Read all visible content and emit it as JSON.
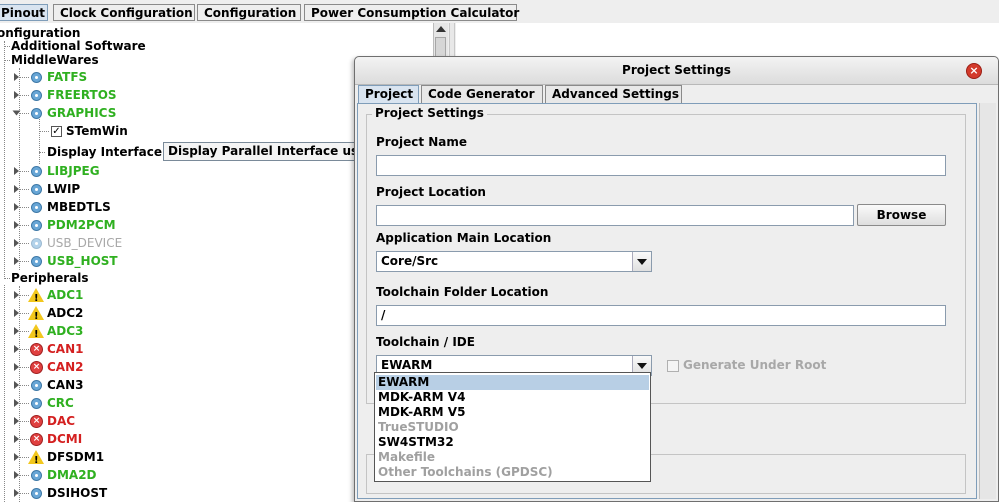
{
  "top_tabs": [
    "Pinout",
    "Clock Configuration",
    "Configuration",
    "Power Consumption Calculator"
  ],
  "tree": {
    "root": "onfiguration",
    "additional": "Additional Software",
    "middlewares": "MiddleWares",
    "mw_items": [
      "FATFS",
      "FREERTOS",
      "GRAPHICS",
      "LIBJPEG",
      "LWIP",
      "MBEDTLS",
      "PDM2PCM",
      "USB_DEVICE",
      "USB_HOST"
    ],
    "stemwin": "STemWin",
    "display_interface_label": "Display Interface",
    "display_interface_value": "Display Parallel Interface using",
    "peripherals": "Peripherals",
    "periph_items": [
      "ADC1",
      "ADC2",
      "ADC3",
      "CAN1",
      "CAN2",
      "CAN3",
      "CRC",
      "DAC",
      "DCMI",
      "DFSDM1",
      "DMA2D",
      "DSIHOST"
    ]
  },
  "dialog": {
    "title": "Project Settings",
    "close": "×",
    "tabs": [
      "Project",
      "Code Generator",
      "Advanced Settings"
    ],
    "group_title": "Project Settings",
    "project_name_label": "Project Name",
    "project_name_value": "",
    "project_location_label": "Project Location",
    "project_location_value": "",
    "browse_label": "Browse",
    "app_main_label": "Application Main Location",
    "app_main_value": "Core/Src",
    "toolchain_folder_label": "Toolchain Folder Location",
    "toolchain_folder_value": "/",
    "toolchain_ide_label": "Toolchain / IDE",
    "toolchain_ide_value": "EWARM",
    "generate_under_root_label": "Generate Under Root",
    "generate_under_root_checked": false,
    "toolchain_options": [
      {
        "label": "EWARM",
        "enabled": true,
        "selected": true
      },
      {
        "label": "MDK-ARM V4",
        "enabled": true,
        "selected": false
      },
      {
        "label": "MDK-ARM V5",
        "enabled": true,
        "selected": false
      },
      {
        "label": "TrueSTUDIO",
        "enabled": false,
        "selected": false
      },
      {
        "label": "SW4STM32",
        "enabled": true,
        "selected": false
      },
      {
        "label": "Makefile",
        "enabled": false,
        "selected": false
      },
      {
        "label": "Other Toolchains (GPDSC)",
        "enabled": false,
        "selected": false
      }
    ]
  },
  "colors": {
    "ok_green": "#2fb020",
    "error_red": "#d42020",
    "disabled_grey": "#a8a8a8",
    "selection_blue": "#b8cfe5"
  }
}
